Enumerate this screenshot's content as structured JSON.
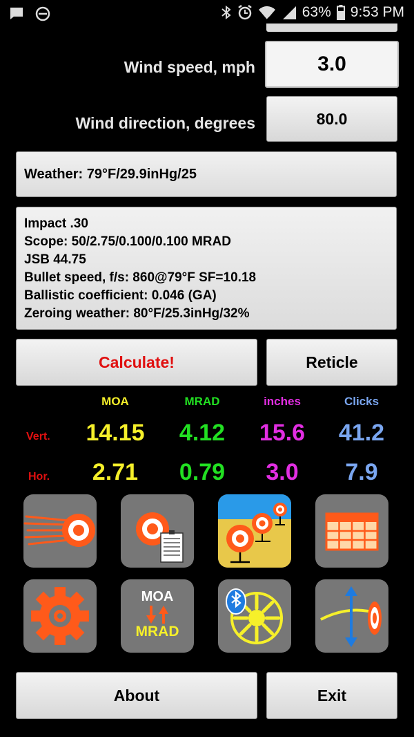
{
  "status_bar": {
    "battery": "63%",
    "time": "9:53 PM"
  },
  "wind_speed": {
    "label": "Wind speed, mph",
    "value": "3.0"
  },
  "wind_direction": {
    "label": "Wind direction, degrees",
    "value": "80.0"
  },
  "weather": {
    "text": "Weather: 79°F/29.9inHg/25"
  },
  "info": {
    "lines": [
      "Impact .30",
      "Scope: 50/2.75/0.100/0.100 MRAD",
      "JSB 44.75",
      "Bullet speed, f/s: 860@79°F SF=10.18",
      "Ballistic coefficient: 0.046 (GA)",
      "Zeroing weather: 80°F/25.3inHg/32%"
    ]
  },
  "buttons": {
    "calculate": "Calculate!",
    "reticle": "Reticle",
    "about": "About",
    "exit": "Exit"
  },
  "results": {
    "headers": {
      "moa": "MOA",
      "mrad": "MRAD",
      "inches": "inches",
      "clicks": "Clicks"
    },
    "vert": {
      "label": "Vert.",
      "moa": "14.15",
      "mrad": "4.12",
      "inches": "15.6",
      "clicks": "41.2"
    },
    "hor": {
      "label": "Hor.",
      "moa": "2.71",
      "mrad": "0.79",
      "inches": "3.0",
      "clicks": "7.9"
    }
  },
  "icons": {
    "moa_mrad_top": "MOA",
    "moa_mrad_bottom": "MRAD"
  },
  "colors": {
    "moa": "#f6f02a",
    "mrad": "#22e022",
    "inches": "#e22ee2",
    "clicks": "#7aa6f0",
    "calculate": "#e01010",
    "target_orange": "#ff5a1a",
    "tile_gray": "#777777"
  }
}
